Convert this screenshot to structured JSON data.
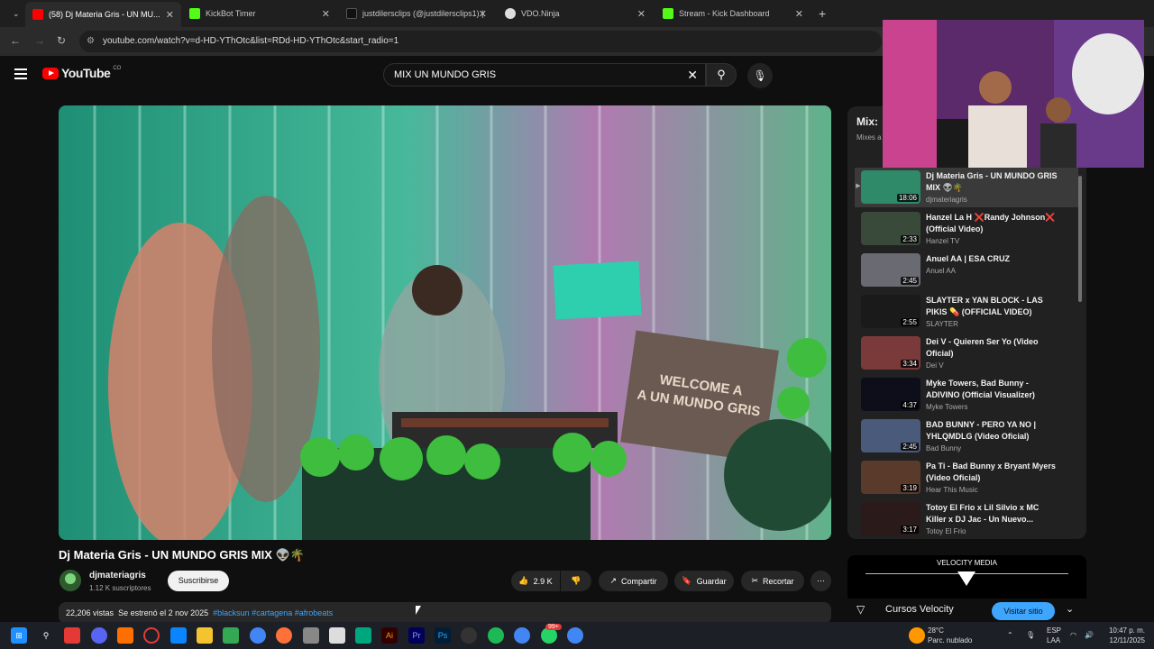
{
  "tabs": [
    {
      "label": "(58) Dj Materia Gris - UN MU..."
    },
    {
      "label": "KickBot Timer"
    },
    {
      "label": "justdilersclips (@justdilersclips1) |"
    },
    {
      "label": "VDO.Ninja"
    },
    {
      "label": "Stream - Kick Dashboard"
    }
  ],
  "address": {
    "url": "youtube.com/watch?v=d-HD-YThOtc&list=RDd-HD-YThOtc&start_radio=1"
  },
  "youtube": {
    "logo": "YouTube",
    "country": "CO"
  },
  "search": {
    "query": "MIX UN MUNDO GRIS"
  },
  "video": {
    "title": "Dj Materia Gris - UN MUNDO GRIS MIX 👽🌴",
    "channel": "djmateriagris",
    "subscribers": "1.12 K suscriptores",
    "subscribe_label": "Suscribirse",
    "likes": "2.9 K",
    "share_label": "Compartir",
    "save_label": "Guardar",
    "clip_label": "Recortar",
    "views": "22,206 vistas",
    "premiered": "Se estrenó el 2 nov 2025",
    "tags": "#blacksun #cartagena #afrobeats"
  },
  "sidebar": {
    "mix_title": "Mix:",
    "mix_sub": "Mixes a",
    "items": [
      {
        "title": "Dj Materia Gris - UN MUNDO GRIS MIX 👽🌴",
        "channel": "djmateriagris",
        "duration": "18:06"
      },
      {
        "title": "Hanzel La H ❌Randy Johnson❌ (Official Video)",
        "channel": "Hanzel TV",
        "duration": "2:33"
      },
      {
        "title": "Anuel AA | ESA CRUZ",
        "channel": "Anuel AA",
        "duration": "2:45"
      },
      {
        "title": "SLAYTER x YAN BLOCK - LAS PIKIS 💊 (OFFICIAL VIDEO)",
        "channel": "SLAYTER",
        "duration": "2:55"
      },
      {
        "title": "Dei V - Quieren Ser Yo (Video Oficial)",
        "channel": "Dei V",
        "duration": "3:34"
      },
      {
        "title": "Myke Towers, Bad Bunny - ADIVINO (Official Visualizer)",
        "channel": "Myke Towers",
        "duration": "4:37"
      },
      {
        "title": "BAD BUNNY - PERO YA NO | YHLQMDLG (Video Oficial)",
        "channel": "Bad Bunny",
        "duration": "2:45"
      },
      {
        "title": "Pa Ti - Bad Bunny x Bryant Myers (Video Oficial)",
        "channel": "Hear This Music",
        "duration": "3:19"
      },
      {
        "title": "Totoy El Frio x Lil Silvio x MC Killer x DJ Jac - Un Nuevo...",
        "channel": "Totoy El Frio",
        "duration": "3:17"
      }
    ]
  },
  "ad": {
    "brand": "VELOCITY MEDIA",
    "name": "Cursos Velocity",
    "cta": "Visitar sitio"
  },
  "video_overlay": {
    "sign": "WELCOME A\nA UN MUNDO GRIS"
  },
  "tray": {
    "temp": "28°C",
    "weather": "Parc. nublado",
    "lang1": "ESP",
    "lang2": "LAA",
    "time": "10:47 p. m.",
    "date": "12/11/2025",
    "badge": "99+"
  }
}
